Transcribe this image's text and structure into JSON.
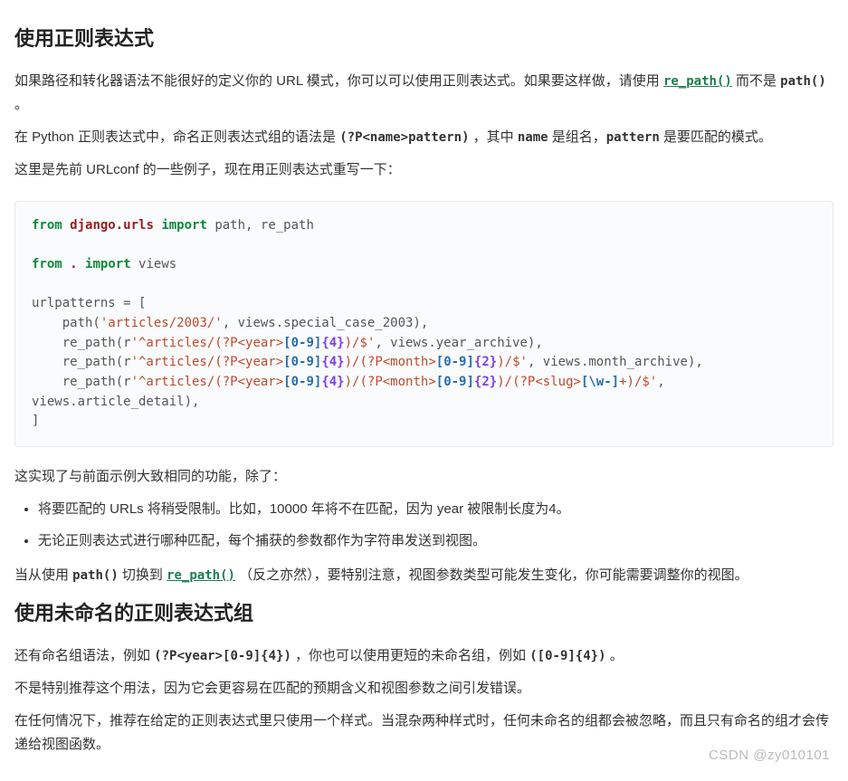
{
  "heading1": "使用正则表达式",
  "intro1_a": "如果路径和转化器语法不能很好的定义你的 URL 模式，你可以可以使用正则表达式。如果要这样做，请使用 ",
  "intro1_link": "re_path()",
  "intro1_b": " 而不是 ",
  "intro1_code": "path()",
  "intro1_c": " 。",
  "intro2_a": "在 Python 正则表达式中，命名正则表达式组的语法是 ",
  "intro2_code1": "(?P<name>pattern)",
  "intro2_b": " ，其中 ",
  "intro2_code2": "name",
  "intro2_c": " 是组名，",
  "intro2_code3": "pattern",
  "intro2_d": " 是要匹配的模式。",
  "intro3": "这里是先前 URLconf 的一些例子，现在用正则表达式重写一下：",
  "code": {
    "from1": "from",
    "mod1": "django.urls",
    "import1": "import",
    "names1": " path, re_path",
    "from2": "from",
    "mod2": ".",
    "import2": "import",
    "names2": " views",
    "line_open": "urlpatterns = [",
    "l1a": "    path(",
    "l1s": "'articles/2003/'",
    "l1b": ", views.special_case_2003),",
    "l2a": "    re_path(r",
    "l2s1": "'^articles/(?P<year>",
    "l2p1": "[0-9]",
    "l2c1": "{4}",
    "l2s2": ")/$'",
    "l2b": ", views.year_archive),",
    "l3a": "    re_path(r",
    "l3s1": "'^articles/(?P<year>",
    "l3p1": "[0-9]",
    "l3c1": "{4}",
    "l3s2": ")/(?P<month>",
    "l3p2": "[0-9]",
    "l3c2": "{2}",
    "l3s3": ")/$'",
    "l3b": ", views.month_archive),",
    "l4a": "    re_path(r",
    "l4s1": "'^articles/(?P<year>",
    "l4p1": "[0-9]",
    "l4c1": "{4}",
    "l4s2": ")/(?P<month>",
    "l4p2": "[0-9]",
    "l4c2": "{2}",
    "l4s3": ")/(?P<slug>",
    "l4p3": "[\\w-]",
    "l4s4": "+)/$'",
    "l4b": ", ",
    "l4wrap": "views.article_detail),",
    "line_close": "]"
  },
  "after1": "这实现了与前面示例大致相同的功能，除了：",
  "bullet1": "将要匹配的 URLs 将稍受限制。比如，10000 年将不在匹配，因为 year 被限制长度为4。",
  "bullet2": "无论正则表达式进行哪种匹配，每个捕获的参数都作为字符串发送到视图。",
  "after2_a": "当从使用 ",
  "after2_code1": "path()",
  "after2_b": " 切换到 ",
  "after2_link": "re_path()",
  "after2_c": " （反之亦然），要特别注意，视图参数类型可能发生变化，你可能需要调整你的视图。",
  "heading2": "使用未命名的正则表达式组",
  "sec2_p1_a": "还有命名组语法，例如 ",
  "sec2_code1": "(?P<year>[0-9]{4})",
  "sec2_p1_b": " ，你也可以使用更短的未命名组，例如 ",
  "sec2_code2": "([0-9]{4})",
  "sec2_p1_c": " 。",
  "sec2_p2": "不是特别推荐这个用法，因为它会更容易在匹配的预期含义和视图参数之间引发错误。",
  "sec2_p3": "在任何情况下，推荐在给定的正则表达式里只使用一个样式。当混杂两种样式时，任何未命名的组都会被忽略，而且只有命名的组才会传递给视图函数。",
  "watermark": "CSDN @zy010101"
}
